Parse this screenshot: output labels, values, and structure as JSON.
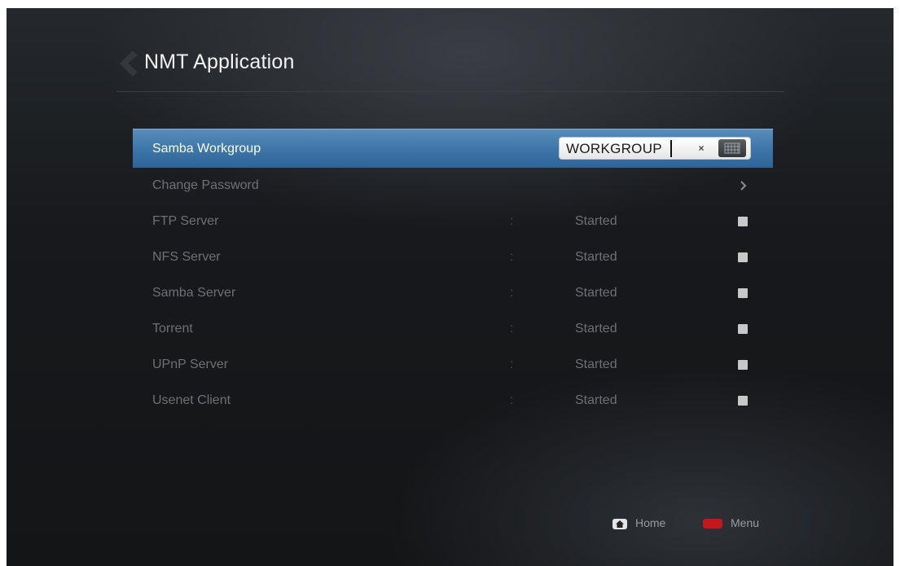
{
  "header": {
    "title": "NMT Application",
    "back_icon": "chevron-left-icon"
  },
  "settings": {
    "samba_workgroup": {
      "label": "Samba Workgroup",
      "value": "WORKGROUP",
      "clear_symbol": "×",
      "keyboard_icon": "keyboard-icon"
    },
    "change_password": {
      "label": "Change Password",
      "icon": "chevron-right-icon"
    },
    "services": [
      {
        "label": "FTP Server",
        "separator": ":",
        "status": "Started",
        "enabled": true
      },
      {
        "label": "NFS Server",
        "separator": ":",
        "status": "Started",
        "enabled": true
      },
      {
        "label": "Samba Server",
        "separator": ":",
        "status": "Started",
        "enabled": true
      },
      {
        "label": "Torrent",
        "separator": ":",
        "status": "Started",
        "enabled": true
      },
      {
        "label": "UPnP Server",
        "separator": ":",
        "status": "Started",
        "enabled": true
      },
      {
        "label": "Usenet Client",
        "separator": ":",
        "status": "Started",
        "enabled": true
      }
    ]
  },
  "footer": {
    "home_label": "Home",
    "home_icon": "home-key-icon",
    "menu_label": "Menu",
    "menu_icon": "red-key-icon",
    "menu_key_color": "#c4161c"
  },
  "colors": {
    "selection": "#3f79ab",
    "background": "#17191c"
  }
}
